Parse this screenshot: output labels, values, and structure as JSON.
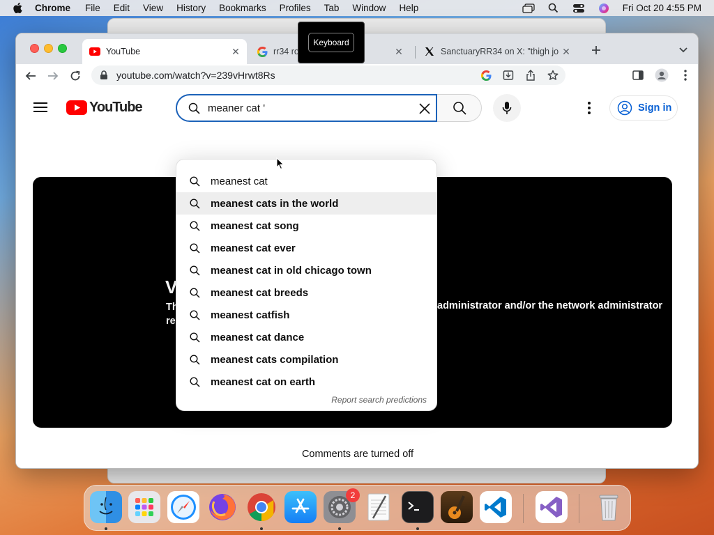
{
  "menubar": {
    "app": "Chrome",
    "items": [
      "File",
      "Edit",
      "View",
      "History",
      "Bookmarks",
      "Profiles",
      "Tab",
      "Window",
      "Help"
    ],
    "clock": "Fri Oct 20  4:55 PM"
  },
  "tooltip": {
    "label": "Keyboard"
  },
  "tabs": [
    {
      "title": "YouTube",
      "icon": "youtube-icon",
      "active": true
    },
    {
      "title": "rr34 ro... ...ogle Se",
      "icon": "google-icon",
      "active": false
    },
    {
      "title": "SanctuaryRR34 on X: \"thigh jo",
      "icon": "x-icon",
      "active": false
    }
  ],
  "toolbar": {
    "url": "youtube.com/watch?v=239vHrwt8Rs"
  },
  "youtube": {
    "logo_text": "YouTube",
    "search": {
      "value": "meaner cat '"
    },
    "signin_label": "Sign in",
    "suggestions": [
      {
        "prefix": "meanest cat",
        "suffix": ""
      },
      {
        "prefix": "meanest cat",
        "suffix": "s in the world"
      },
      {
        "prefix": "meanest cat",
        "suffix": " song"
      },
      {
        "prefix": "meanest cat",
        "suffix": " ever"
      },
      {
        "prefix": "meanest cat",
        "suffix": " in old chicago town"
      },
      {
        "prefix": "meanest cat",
        "suffix": " breeds"
      },
      {
        "prefix": "meanest cat",
        "suffix": "fish"
      },
      {
        "prefix": "meanest cat",
        "suffix": " dance"
      },
      {
        "prefix": "meanest cat",
        "suffix": "s compilation"
      },
      {
        "prefix": "meanest cat",
        "suffix": " on earth"
      }
    ],
    "report_label": "Report search predictions",
    "player": {
      "err_title_visible": "V",
      "err_line1_start": "Th",
      "err_line2_start": "re",
      "err_line1_end": "administrator and/or the network administrator"
    },
    "comments_off": "Comments are turned off"
  },
  "dock": {
    "apps": [
      "Finder",
      "Launchpad",
      "Safari",
      "Firefox",
      "Chrome",
      "App Store",
      "System Settings",
      "TextEdit",
      "Terminal",
      "GarageBand",
      "Visual Studio Code",
      "Visual Studio",
      "Trash"
    ],
    "settings_badge": "2"
  },
  "colors": {
    "youtube_red": "#ff0000",
    "link_blue": "#065fd4",
    "search_focus": "#1c62b9"
  }
}
